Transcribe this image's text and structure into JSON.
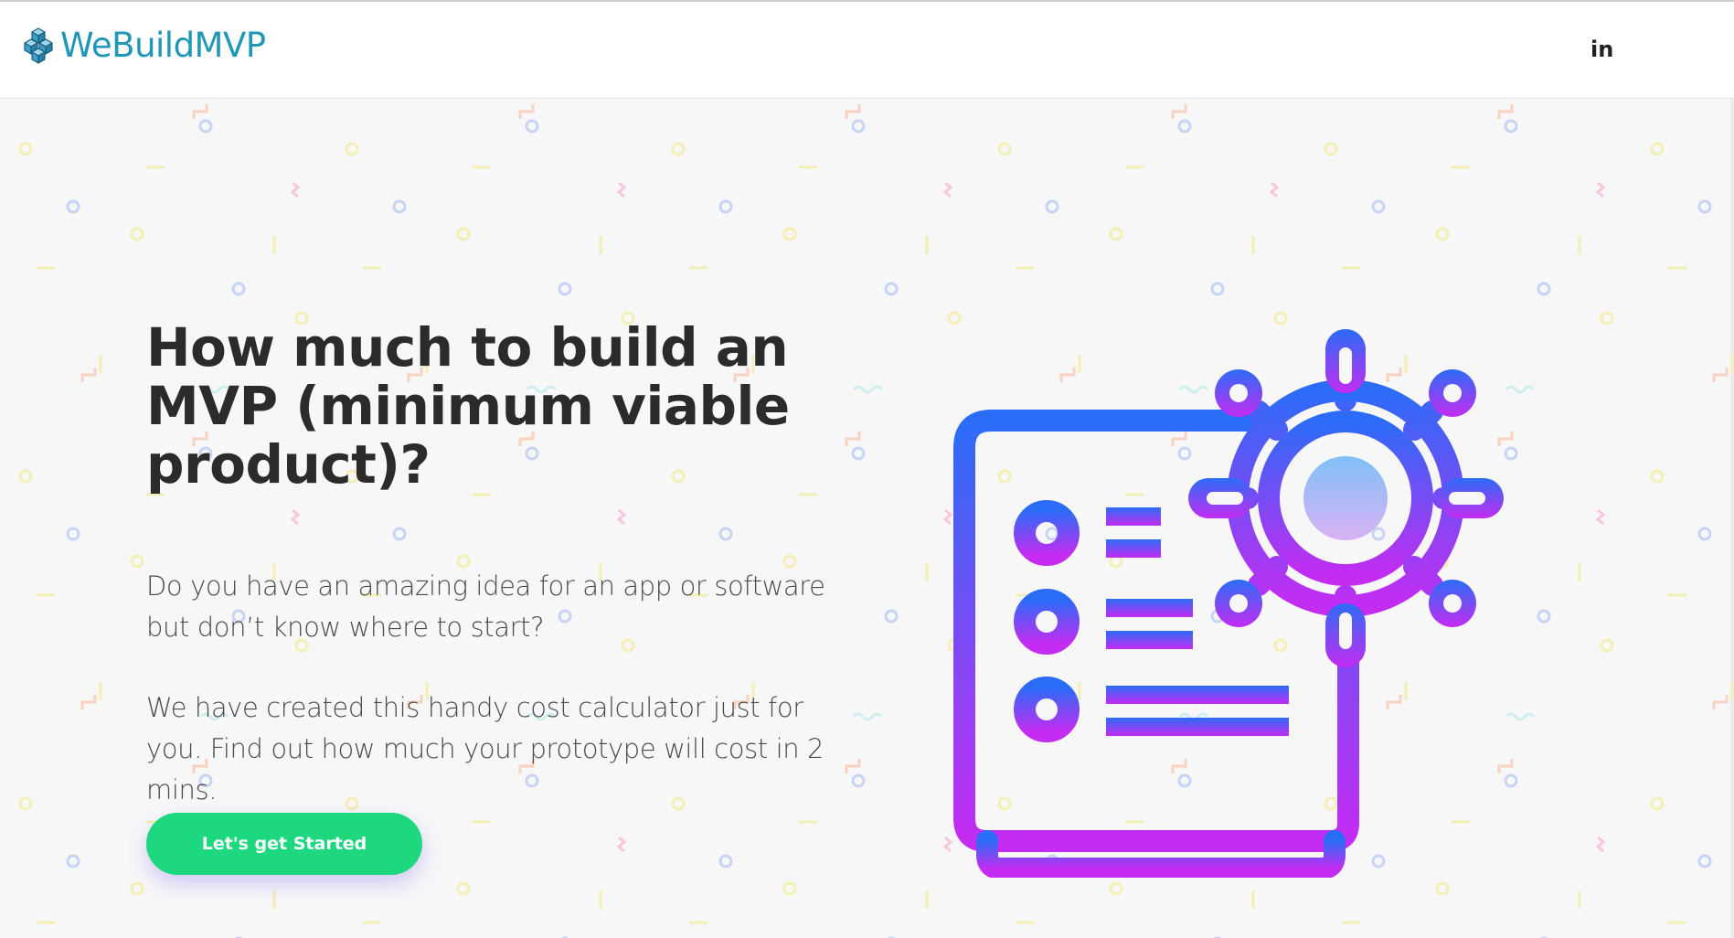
{
  "header": {
    "brand_name": "WeBuildMVP",
    "linkedin_label": "in"
  },
  "hero": {
    "title": "How much to build an MVP (minimum viable product)?",
    "paragraph_1": "Do you have an amazing idea for an app or software but don’t know where to start?",
    "paragraph_2": "We have created this handy cost calculator just for you. Find out how much your prototype will cost in 2 mins.",
    "cta_label": "Let's get Started"
  },
  "colors": {
    "brand": "#2196b6",
    "cta": "#1ed87f",
    "illustration_gradient_top": "#2b6cf6",
    "illustration_gradient_bottom": "#c42cf2",
    "heading": "#2b2b2b"
  },
  "icons": {
    "logo": "stacked-cubes-icon",
    "social": "linkedin-icon",
    "illustration": "settings-document-icon"
  }
}
